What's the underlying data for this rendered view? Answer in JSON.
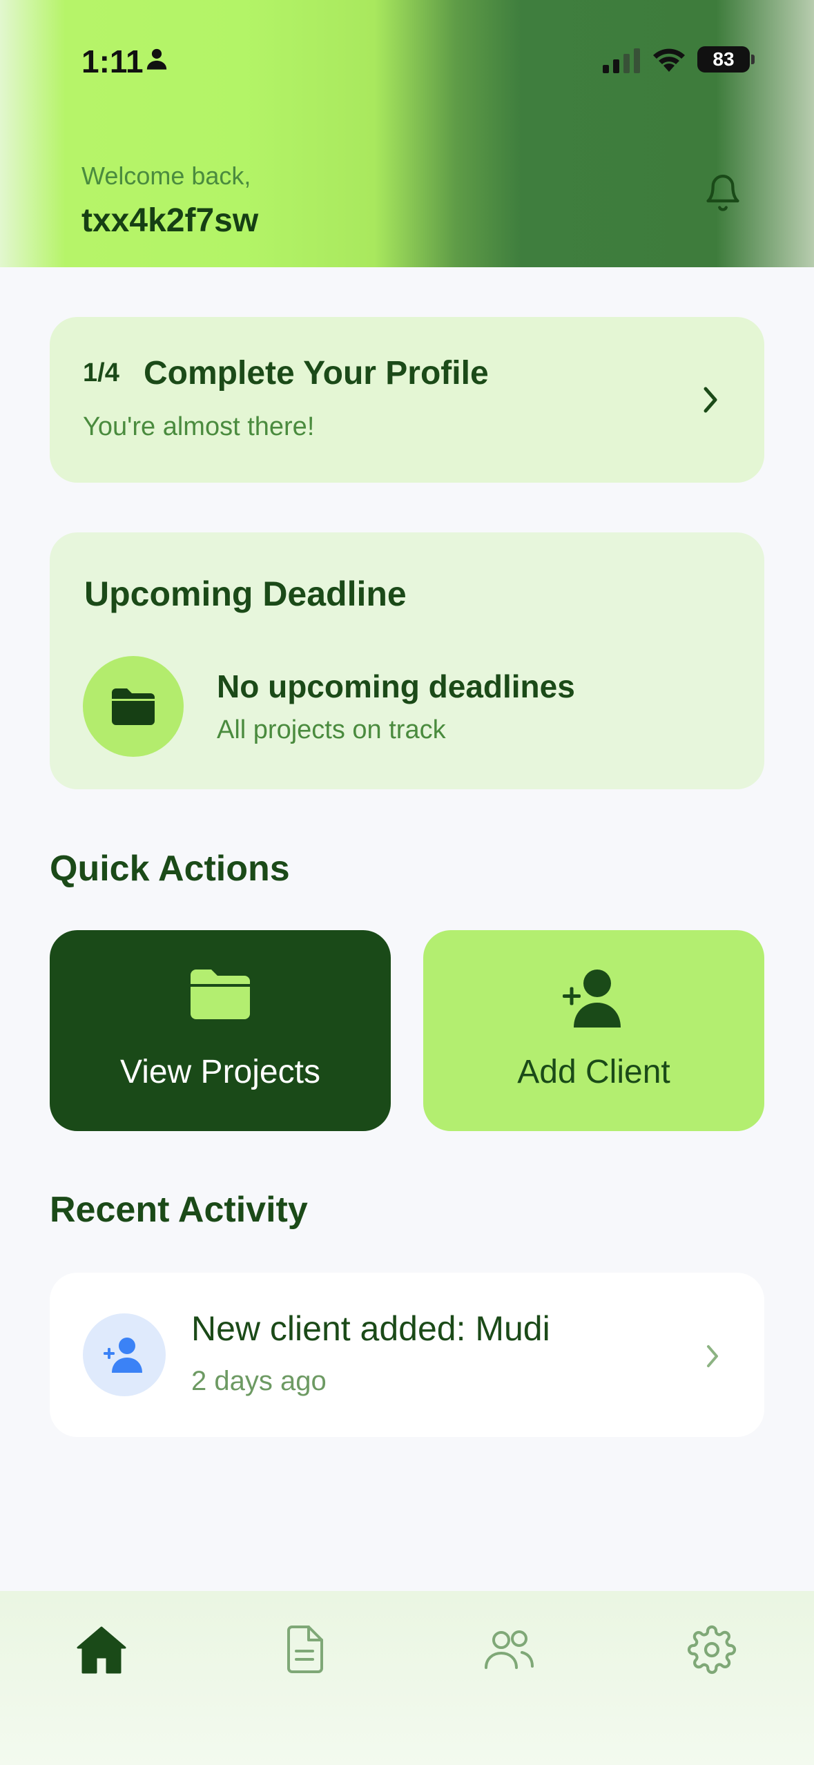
{
  "status_bar": {
    "time": "1:11",
    "battery": "83"
  },
  "header": {
    "welcome": "Welcome back,",
    "username": "txx4k2f7sw"
  },
  "profile_card": {
    "step": "1/4",
    "title": "Complete Your Profile",
    "subtitle": "You're almost there!"
  },
  "deadline_card": {
    "title": "Upcoming Deadline",
    "main": "No upcoming deadlines",
    "sub": "All projects on track",
    "icon": "folder-icon"
  },
  "quick_actions": {
    "title": "Quick Actions",
    "items": [
      {
        "label": "View Projects",
        "icon": "folder-open-icon"
      },
      {
        "label": "Add Client",
        "icon": "user-plus-icon"
      }
    ]
  },
  "recent_activity": {
    "title": "Recent Activity",
    "items": [
      {
        "title": "New client added: Mudi",
        "time": "2 days ago",
        "icon": "user-plus-icon"
      }
    ]
  },
  "bottom_nav": {
    "items": [
      {
        "icon": "home-icon",
        "active": true
      },
      {
        "icon": "document-icon",
        "active": false
      },
      {
        "icon": "users-icon",
        "active": false
      },
      {
        "icon": "gear-icon",
        "active": false
      }
    ]
  },
  "colors": {
    "primary_dark": "#1a4a18",
    "accent_green": "#b3ee70",
    "muted_green": "#4a8b3e",
    "activity_blue": "#3b82f6"
  }
}
